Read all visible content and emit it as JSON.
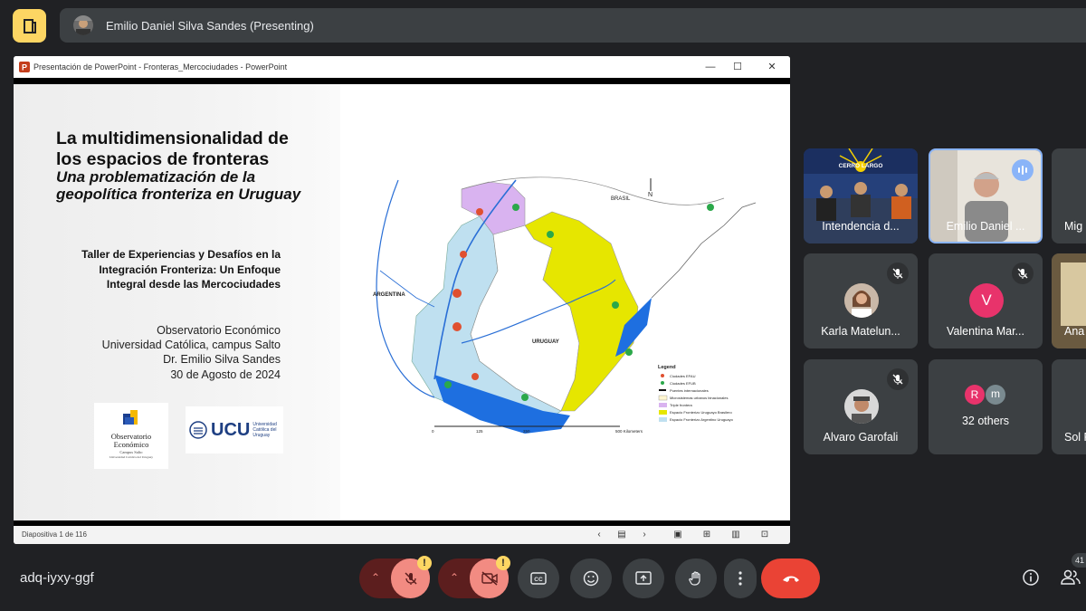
{
  "top_bar": {
    "presenting_label": "Emilio Daniel Silva Sandes (Presenting)"
  },
  "ppt_window": {
    "title": "Presentación de PowerPoint  -  Fronteras_Mercociudades - PowerPoint",
    "status": "Diapositiva 1 de 116"
  },
  "slide": {
    "title_line1": "La multidimensionalidad de",
    "title_line2": "los espacios de fronteras",
    "subtitle_line1": "Una problematización de la",
    "subtitle_line2": "geopolítica fronteriza en Uruguay",
    "workshop_line1": "Taller de Experiencias y Desafíos en la",
    "workshop_line2": "Integración Fronteriza: Un Enfoque",
    "workshop_line3": "Integral desde las Mercociudades",
    "info_line1": "Observatorio Económico",
    "info_line2": "Universidad Católica, campus Salto",
    "info_line3": "Dr. Emilio Silva Sandes",
    "info_line4": "30  de Agosto  de 2024",
    "logo1_line1": "Observatorio",
    "logo1_line2": "Económico",
    "logo1_line3": "Campus Salto",
    "logo1_line4": "Universidad Católica del Uruguay",
    "logo2_text": "UCU",
    "logo2_sub1": "Universidad",
    "logo2_sub2": "Católica del",
    "logo2_sub3": "Uruguay"
  },
  "map": {
    "country_brasil": "BRASIL",
    "country_argentina": "ARGENTINA",
    "country_uruguay": "URUGUAY",
    "north": "N",
    "scale": [
      "0",
      "125",
      "250",
      "500 Kilometers"
    ],
    "legend_title": "Legend",
    "legend": [
      "Ciudades EFAU",
      "Ciudades EFUB",
      "Puentes internacionales",
      "Microsistemas urbanos binacionales",
      "Triple frontera",
      "Espacio Fronterizo Uruguayo Brasilero",
      "Espacio Fronterizo Argentino Uruguayo"
    ],
    "colors": {
      "efab": "#bfe0f0",
      "efub": "#e6e600",
      "triple": "#d9b3f0",
      "water": "#1e6fe0"
    }
  },
  "participants": [
    {
      "name": "Intendencia d...",
      "banner": "CERRO LARGO"
    },
    {
      "name": "Emilio Daniel ..."
    },
    {
      "name": "Mig"
    },
    {
      "name": "Karla Matelun..."
    },
    {
      "name": "Valentina Mar...",
      "initial": "V"
    },
    {
      "name": "Ana"
    },
    {
      "name": "Alvaro Garofali"
    },
    {
      "name": "32 others",
      "initials": [
        "R",
        "m"
      ]
    },
    {
      "name": "Sol R"
    }
  ],
  "bottom_bar": {
    "meeting_code": "adq-iyxy-ggf",
    "participant_count": "41",
    "warn": "!"
  }
}
